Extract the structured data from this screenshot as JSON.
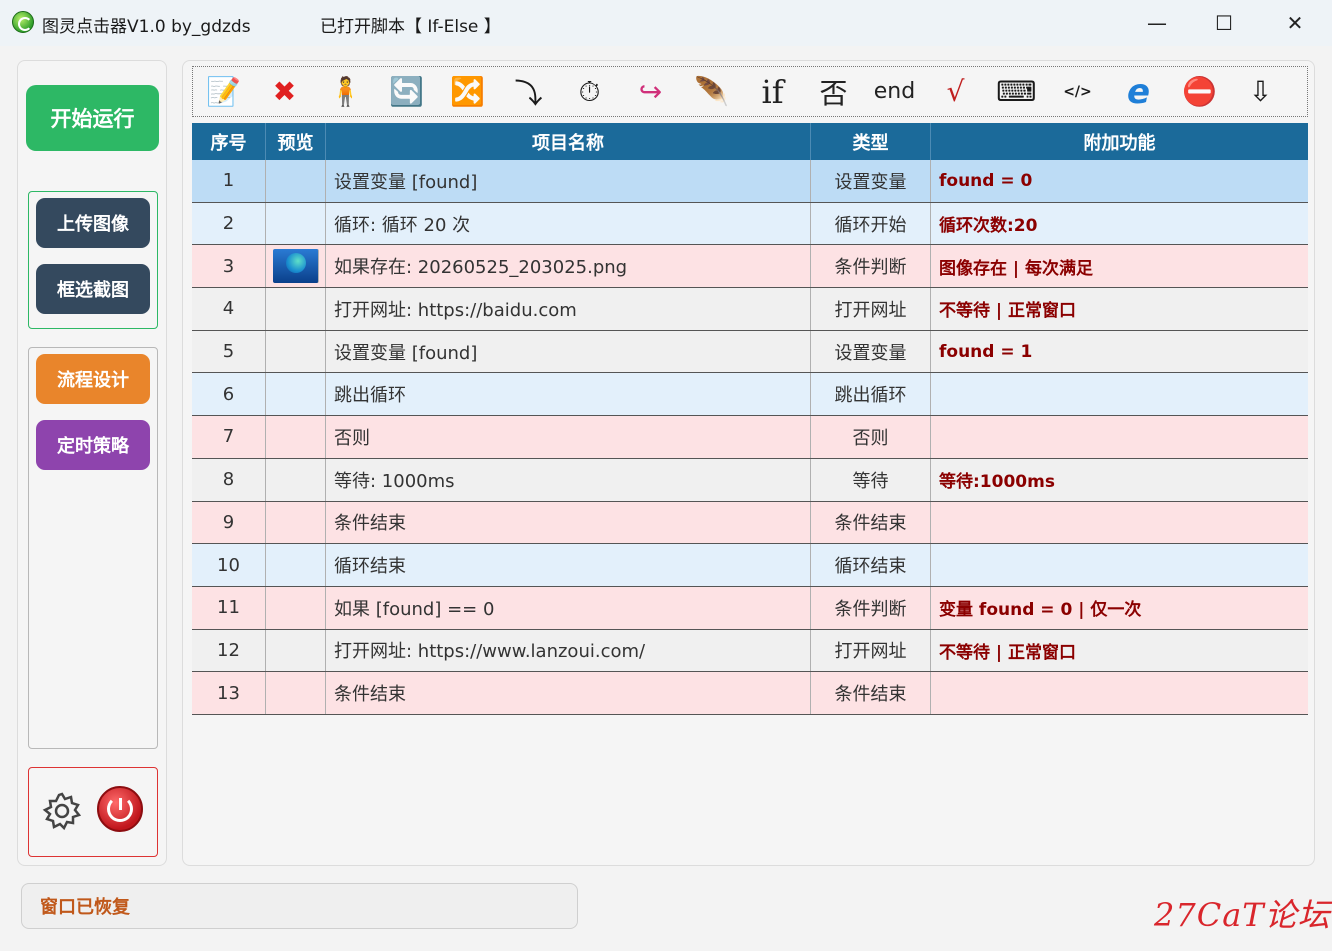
{
  "window": {
    "app_title": "图灵点击器V1.0 by_gdzds",
    "script_title": "已打开脚本【 If-Else 】",
    "minimize": "—",
    "maximize": "☐",
    "close": "✕"
  },
  "sidebar": {
    "start_label": "开始运行",
    "upload_label": "上传图像",
    "crop_label": "框选截图",
    "flow_label": "流程设计",
    "timer_label": "定时策略",
    "start_color": "#2db865",
    "dark_color": "#34495e",
    "flow_color": "#e9852b",
    "timer_color": "#8e44ad"
  },
  "toolbar": {
    "items": [
      {
        "icon": "edit-icon",
        "glyph": "📝"
      },
      {
        "icon": "delete-icon",
        "glyph": "✖"
      },
      {
        "icon": "person-icon",
        "glyph": "🧍"
      },
      {
        "icon": "loop-icon",
        "glyph": "🔄"
      },
      {
        "icon": "shuffle-icon",
        "glyph": "🔀"
      },
      {
        "icon": "jump-icon",
        "glyph": "⤵"
      },
      {
        "icon": "stopwatch-icon",
        "glyph": "⏱"
      },
      {
        "icon": "redo-icon",
        "glyph": "↪"
      },
      {
        "icon": "feather-icon",
        "glyph": "🪶"
      },
      {
        "icon": "if-icon",
        "glyph": "if"
      },
      {
        "icon": "else-icon",
        "glyph": "否"
      },
      {
        "icon": "end-icon",
        "glyph": "end"
      },
      {
        "icon": "variable-icon",
        "glyph": "√"
      },
      {
        "icon": "keyboard-icon",
        "glyph": "⌨"
      },
      {
        "icon": "script-icon",
        "glyph": "</>"
      },
      {
        "icon": "browser-icon",
        "glyph": "e"
      },
      {
        "icon": "stop-icon",
        "glyph": "⛔"
      },
      {
        "icon": "down-arrow-icon",
        "glyph": "⇩"
      }
    ]
  },
  "table": {
    "headers": [
      "序号",
      "预览",
      "项目名称",
      "类型",
      "附加功能"
    ],
    "rows": [
      {
        "no": "1",
        "name": "设置变量 [found]",
        "type": "设置变量",
        "extra": "found = 0",
        "style": "sel",
        "thumb": false
      },
      {
        "no": "2",
        "name": "循环: 循环 20 次",
        "type": "循环开始",
        "extra": "循环次数:20",
        "style": "blue",
        "thumb": false
      },
      {
        "no": "3",
        "name": "如果存在: 20260525_203025.png",
        "type": "条件判断",
        "extra": "图像存在 | 每次满足",
        "style": "pink",
        "thumb": true
      },
      {
        "no": "4",
        "name": "打开网址: https://baidu.com",
        "type": "打开网址",
        "extra": "不等待 | 正常窗口",
        "style": "grey",
        "thumb": false
      },
      {
        "no": "5",
        "name": "设置变量 [found]",
        "type": "设置变量",
        "extra": "found = 1",
        "style": "grey",
        "thumb": false
      },
      {
        "no": "6",
        "name": "跳出循环",
        "type": "跳出循环",
        "extra": "",
        "style": "blue",
        "thumb": false
      },
      {
        "no": "7",
        "name": "否则",
        "type": "否则",
        "extra": "",
        "style": "pink",
        "thumb": false
      },
      {
        "no": "8",
        "name": "等待: 1000ms",
        "type": "等待",
        "extra": "等待:1000ms",
        "style": "grey",
        "thumb": false
      },
      {
        "no": "9",
        "name": "条件结束",
        "type": "条件结束",
        "extra": "",
        "style": "pink",
        "thumb": false
      },
      {
        "no": "10",
        "name": "循环结束",
        "type": "循环结束",
        "extra": "",
        "style": "blue",
        "thumb": false
      },
      {
        "no": "11",
        "name": "如果 [found] == 0",
        "type": "条件判断",
        "extra": "变量 found = 0 | 仅一次",
        "style": "pink",
        "thumb": false
      },
      {
        "no": "12",
        "name": "打开网址: https://www.lanzoui.com/",
        "type": "打开网址",
        "extra": "不等待 | 正常窗口",
        "style": "grey",
        "thumb": false
      },
      {
        "no": "13",
        "name": "条件结束",
        "type": "条件结束",
        "extra": "",
        "style": "pink",
        "thumb": false
      }
    ]
  },
  "status": {
    "text": "窗口已恢复"
  },
  "watermark": "27CaT论坛"
}
